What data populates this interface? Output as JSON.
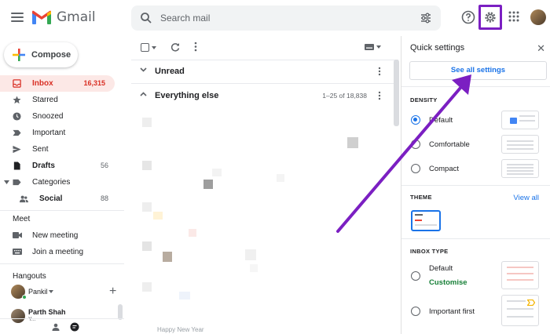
{
  "header": {
    "app_name": "Gmail",
    "search_placeholder": "Search mail"
  },
  "sidebar": {
    "compose_label": "Compose",
    "items": [
      {
        "label": "Inbox",
        "count": "16,315",
        "icon": "inbox-icon",
        "active": true
      },
      {
        "label": "Starred",
        "count": "",
        "icon": "star-icon"
      },
      {
        "label": "Snoozed",
        "count": "",
        "icon": "clock-icon"
      },
      {
        "label": "Important",
        "count": "",
        "icon": "important-icon"
      },
      {
        "label": "Sent",
        "count": "",
        "icon": "send-icon"
      },
      {
        "label": "Drafts",
        "count": "56",
        "icon": "draft-icon",
        "bold": true
      },
      {
        "label": "Categories",
        "count": "",
        "icon": "label-icon"
      },
      {
        "label": "Social",
        "count": "88",
        "icon": "people-icon",
        "bold": true
      }
    ],
    "meet": {
      "title": "Meet",
      "new_meeting": "New meeting",
      "join_meeting": "Join a meeting"
    },
    "hangouts": {
      "title": "Hangouts",
      "user": "Pankil",
      "contact": "Parth Shah",
      "contact_sub": "Y..."
    }
  },
  "mail": {
    "sections": [
      {
        "title": "Unread",
        "expanded": false
      },
      {
        "title": "Everything else",
        "expanded": true,
        "range": "1–25 of 18,838"
      }
    ],
    "bottom_text": "Happy New Year"
  },
  "quick_settings": {
    "title": "Quick settings",
    "see_all": "See all settings",
    "density": {
      "title": "DENSITY",
      "options": [
        {
          "label": "Default",
          "selected": true
        },
        {
          "label": "Comfortable",
          "selected": false
        },
        {
          "label": "Compact",
          "selected": false
        }
      ]
    },
    "theme": {
      "title": "THEME",
      "view_all": "View all"
    },
    "inbox_type": {
      "title": "INBOX TYPE",
      "options": [
        {
          "label": "Default",
          "selected": false,
          "sub": "Customise"
        },
        {
          "label": "Important first",
          "selected": false
        }
      ]
    }
  },
  "colors": {
    "accent": "#1a73e8",
    "active_red": "#d93025",
    "highlight": "#7b1fc2"
  }
}
